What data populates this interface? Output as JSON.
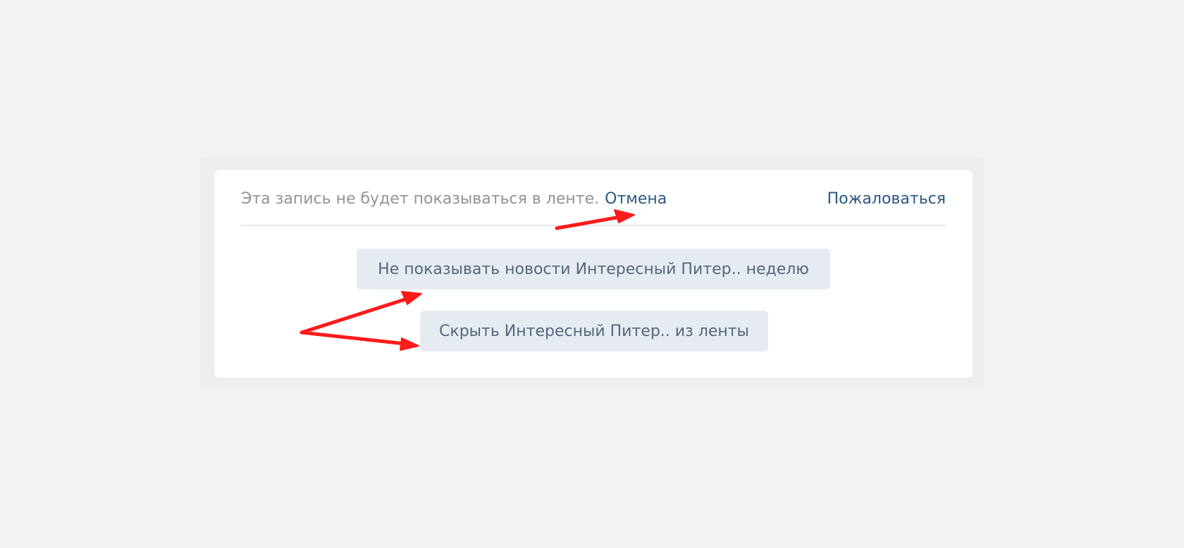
{
  "hidden_post": {
    "info_text": "Эта запись не будет показываться в ленте.",
    "cancel_label": "Отмена",
    "report_label": "Пожаловаться",
    "hide_week_label": "Не показывать новости Интересный Питер.. неделю",
    "hide_source_label": "Скрыть Интересный Питер.. из ленты"
  },
  "colors": {
    "page_background": "#f2f2f2",
    "card_background": "#ffffff",
    "link": "#2a5885",
    "muted_text": "#939393",
    "button_background": "#e5ebf1",
    "button_text": "#55677d",
    "annotation_arrow": "#ff1a1a"
  }
}
